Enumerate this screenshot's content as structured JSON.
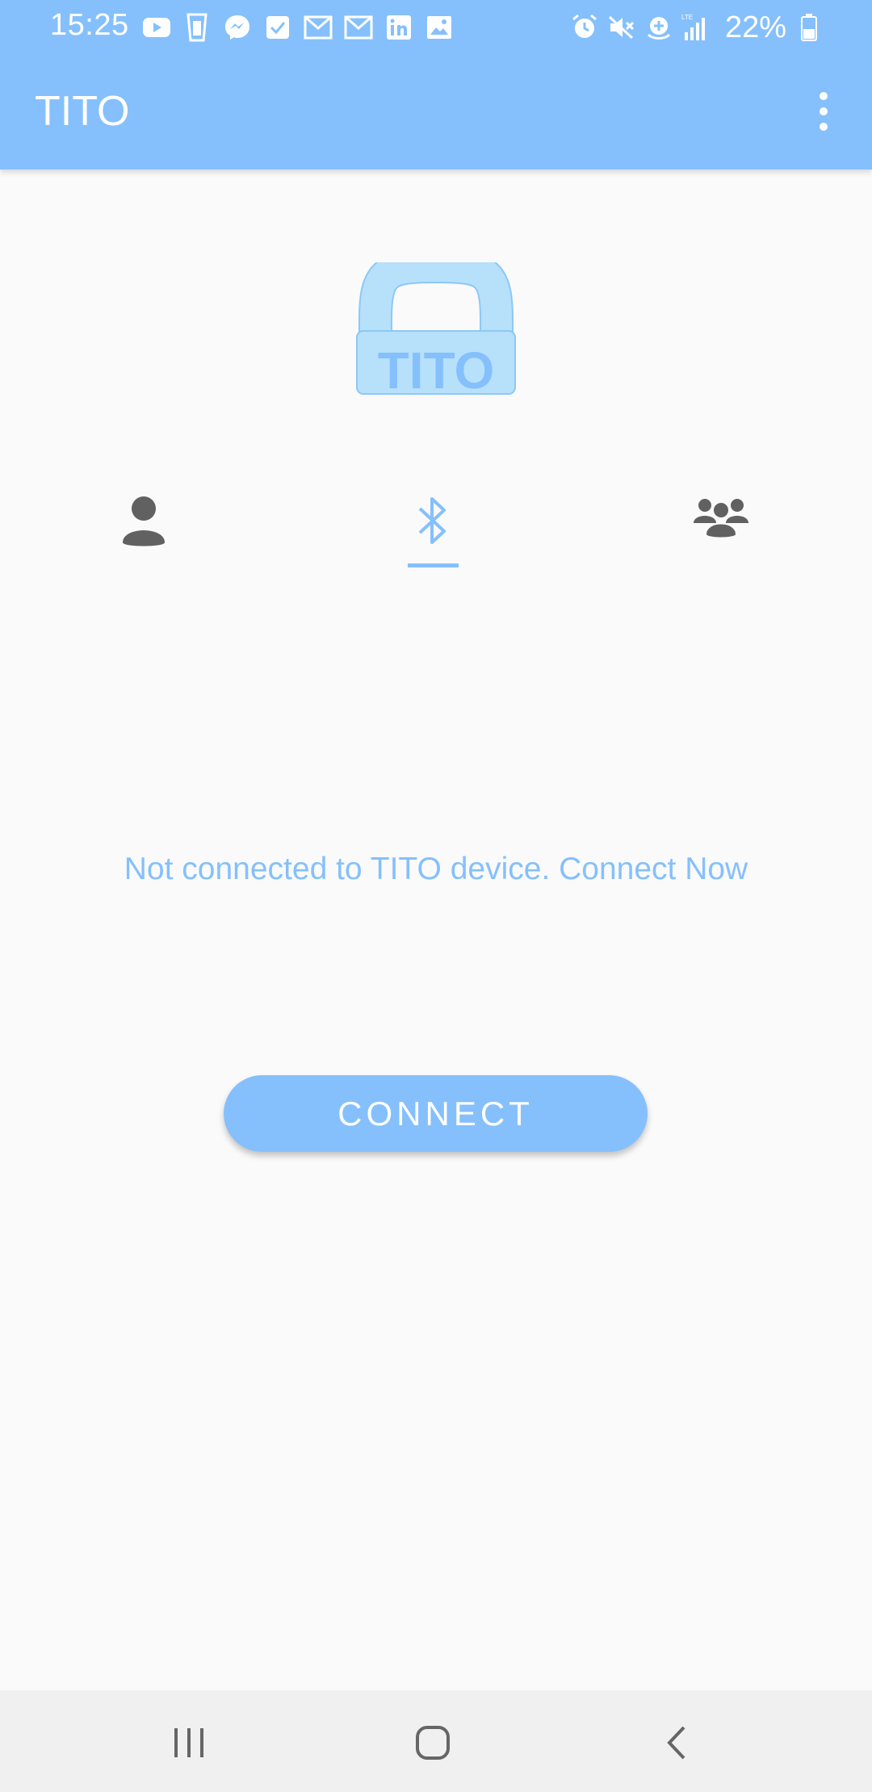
{
  "status_bar": {
    "time": "15:25",
    "battery": "22%",
    "notification_icons": [
      "youtube-icon",
      "glass-icon",
      "messenger-icon",
      "check-icon",
      "gmail-icon",
      "gmail-icon",
      "linkedin-icon",
      "image-icon"
    ],
    "system_icons": [
      "alarm-icon",
      "mute-icon",
      "data-saver-icon",
      "lte-signal-icon"
    ]
  },
  "app_bar": {
    "title": "TITO",
    "menu_icon": "more-vert-icon"
  },
  "logo": {
    "text": "TITO"
  },
  "tabs": [
    {
      "icon": "person-icon",
      "active": false
    },
    {
      "icon": "bluetooth-icon",
      "active": true
    },
    {
      "icon": "group-icon",
      "active": false
    }
  ],
  "main": {
    "status_message": "Not connected to TITO device. Connect Now",
    "connect_label": "CONNECT"
  },
  "colors": {
    "primary": "#85c0fc",
    "background": "#fafafa",
    "icon_gray": "#616161"
  },
  "nav_bar": {
    "buttons": [
      "recents-icon",
      "home-icon",
      "back-icon"
    ]
  }
}
